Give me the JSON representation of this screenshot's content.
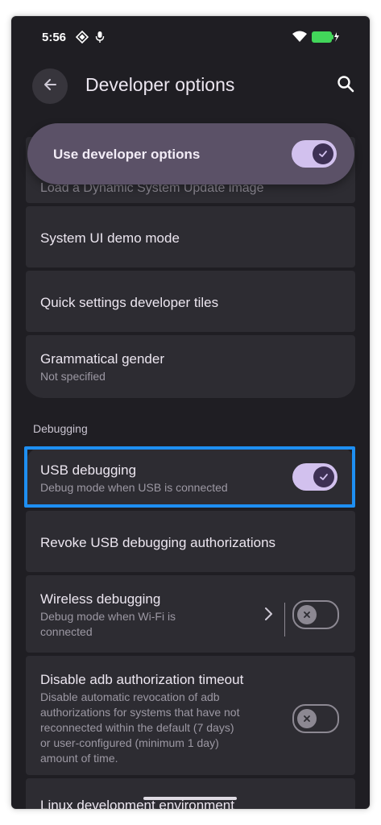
{
  "status_bar": {
    "time": "5:56"
  },
  "header": {
    "title": "Developer options"
  },
  "master_switch": {
    "label": "Use developer options",
    "enabled": true
  },
  "partial_item": {
    "label": "Load a Dynamic System Update image"
  },
  "items": [
    {
      "label": "System UI demo mode"
    },
    {
      "label": "Quick settings developer tiles"
    },
    {
      "label": "Grammatical gender",
      "summary": "Not specified"
    }
  ],
  "debugging": {
    "header": "Debugging",
    "usb": {
      "label": "USB debugging",
      "summary": "Debug mode when USB is connected",
      "enabled": true
    },
    "revoke": {
      "label": "Revoke USB debugging authorizations"
    },
    "wireless": {
      "label": "Wireless debugging",
      "summary_line1": "Debug mode when Wi-Fi is",
      "summary_line2": "connected",
      "enabled": false
    },
    "adb_timeout": {
      "label": "Disable adb authorization timeout",
      "summary_lines": [
        "Disable automatic revocation of adb",
        "authorizations for systems that have not",
        "reconnected within the default (7 days)",
        "or user-configured (minimum 1 day)",
        "amount of time."
      ],
      "enabled": false
    },
    "linux": {
      "label": "Linux development environment"
    }
  },
  "colors": {
    "background": "#1f1e23",
    "card": "#2d2c32",
    "master_switch_bg": "#5b5167",
    "toggle_on_track": "#d2c1ee",
    "highlight_border": "#1e8ff2"
  }
}
